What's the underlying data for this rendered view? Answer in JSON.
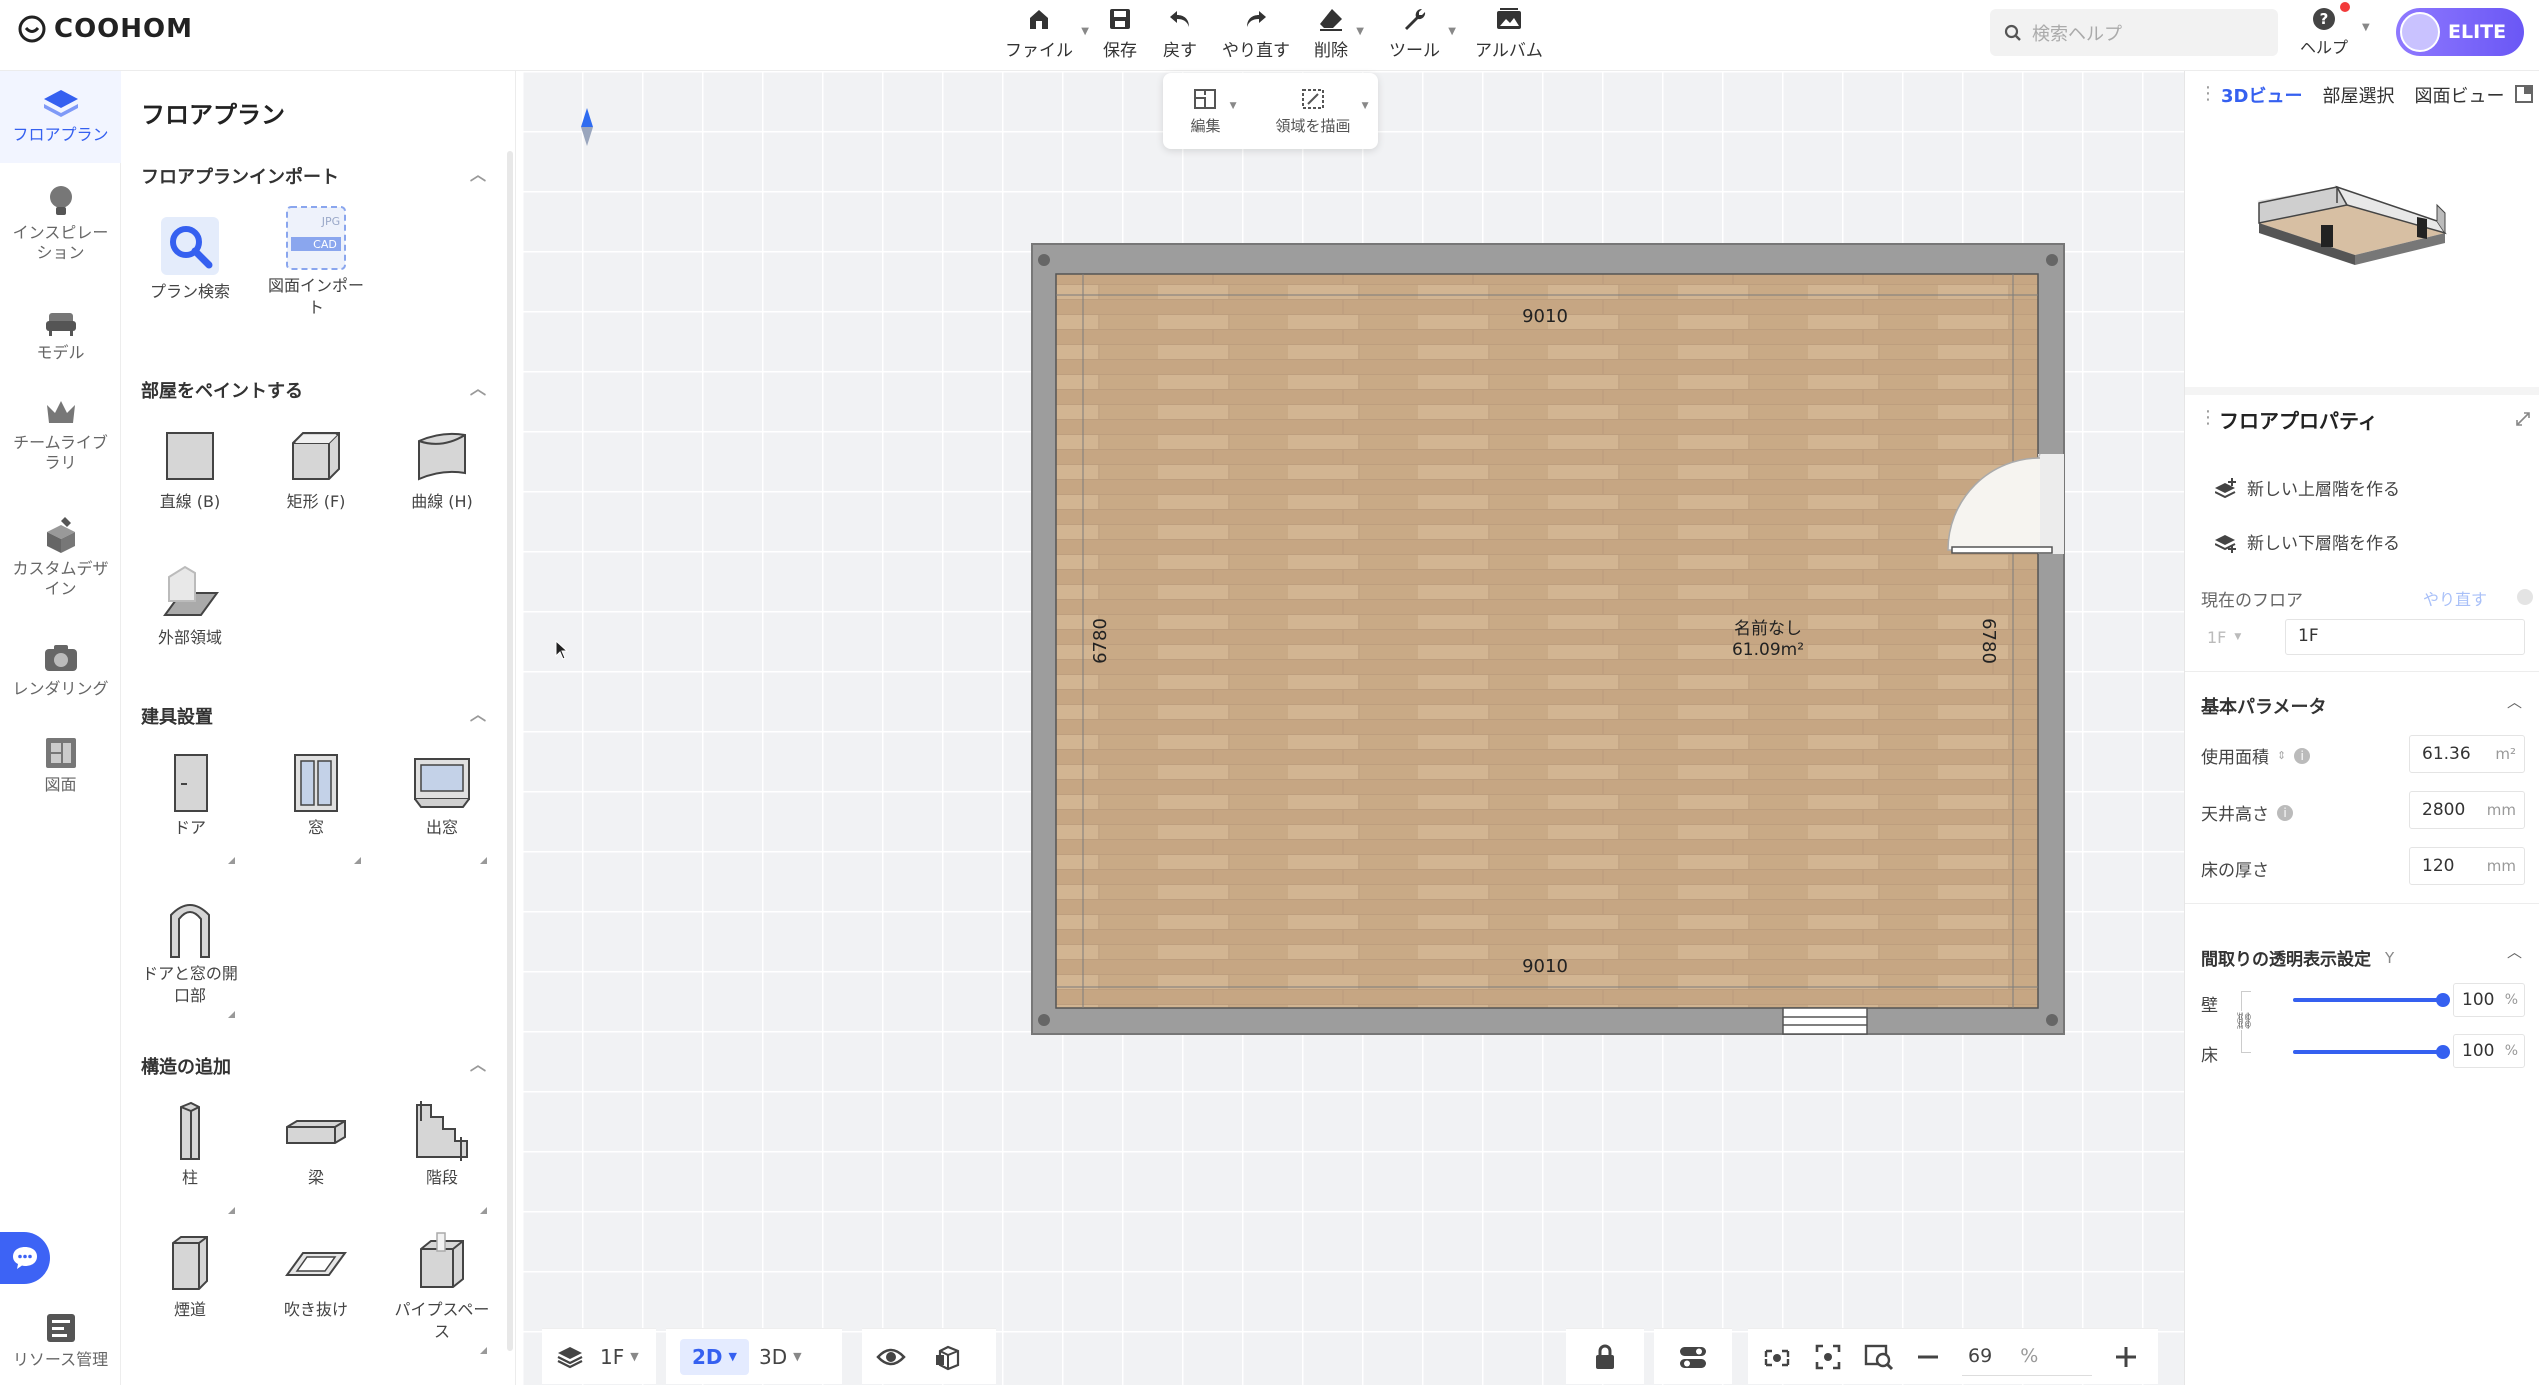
{
  "brand": "COOHOM",
  "toolbar": {
    "file": "ファイル",
    "save": "保存",
    "undo": "戻す",
    "redo": "やり直す",
    "delete": "削除",
    "tools": "ツール",
    "album": "アルバム"
  },
  "search": {
    "placeholder": "検索ヘルプ"
  },
  "help": "ヘルプ",
  "plan": "ELITE",
  "subtoolbar": {
    "edit": "編集",
    "draw_area": "領域を描画"
  },
  "nav": [
    {
      "label": "フロアプラン",
      "icon": "floorplan-icon"
    },
    {
      "label": "インスピレーション",
      "icon": "lightbulb-icon"
    },
    {
      "label": "モデル",
      "icon": "sofa-icon"
    },
    {
      "label": "チームライブラリ",
      "icon": "crown-icon"
    },
    {
      "label": "カスタムデザイン",
      "icon": "custom-design-icon"
    },
    {
      "label": "レンダリング",
      "icon": "camera-icon"
    },
    {
      "label": "図面",
      "icon": "drawing-icon"
    },
    {
      "label": "リソース管理",
      "icon": "resource-icon"
    }
  ],
  "panel": {
    "title": "フロアプラン",
    "import_section": "フロアプランインポート",
    "import_tools": [
      "プラン検索",
      "図面インポート"
    ],
    "paint_section": "部屋をペイントする",
    "paint_tools": [
      "直線 (B)",
      "矩形 (F)",
      "曲線 (H)",
      "外部領域"
    ],
    "fixtures_section": "建具設置",
    "fixture_tools": [
      "ドア",
      "窓",
      "出窓",
      "ドアと窓の開口部"
    ],
    "structure_section": "構造の追加",
    "structure_tools": [
      "柱",
      "梁",
      "階段",
      "煙道",
      "吹き抜け",
      "パイプスペース"
    ],
    "import_badges": [
      "JPG",
      "CAD"
    ]
  },
  "room": {
    "name": "名前なし",
    "area": "61.09m²",
    "dim_top": "9010",
    "dim_bottom": "9010",
    "dim_left": "6780",
    "dim_right": "6780"
  },
  "bottom": {
    "floor": "1F",
    "view_2d": "2D",
    "view_3d": "3D",
    "zoom_value": "69",
    "zoom_unit": "%"
  },
  "right": {
    "tabs": [
      "3Dビュー",
      "部屋選択",
      "図面ビュー"
    ],
    "props_title": "フロアプロパティ",
    "new_upper": "新しい上層階を作る",
    "new_lower": "新しい下層階を作る",
    "current_floor_label": "現在のフロア",
    "current_floor_action": "やり直す",
    "floor_prefix": "1F",
    "floor_value": "1F",
    "basic_params": "基本パラメータ",
    "usable_area_label": "使用面積",
    "usable_area_value": "61.36",
    "usable_area_unit": "m²",
    "ceiling_label": "天井高さ",
    "ceiling_value": "2800",
    "ceiling_unit": "mm",
    "floor_thick_label": "床の厚さ",
    "floor_thick_value": "120",
    "floor_thick_unit": "mm",
    "transparency_title": "間取りの透明表示設定",
    "transparency_hint": "Y",
    "wall_label": "壁",
    "wall_value": "100",
    "floor_label": "床",
    "floor_trans_value": "100",
    "pct": "%",
    "wall_level": 1.0,
    "floor_level": 1.0
  },
  "colors": {
    "accent": "#3560f0",
    "wall": "#9d9d9d",
    "floor_wood": "#c9ab89",
    "elite": "#7a66f7"
  }
}
